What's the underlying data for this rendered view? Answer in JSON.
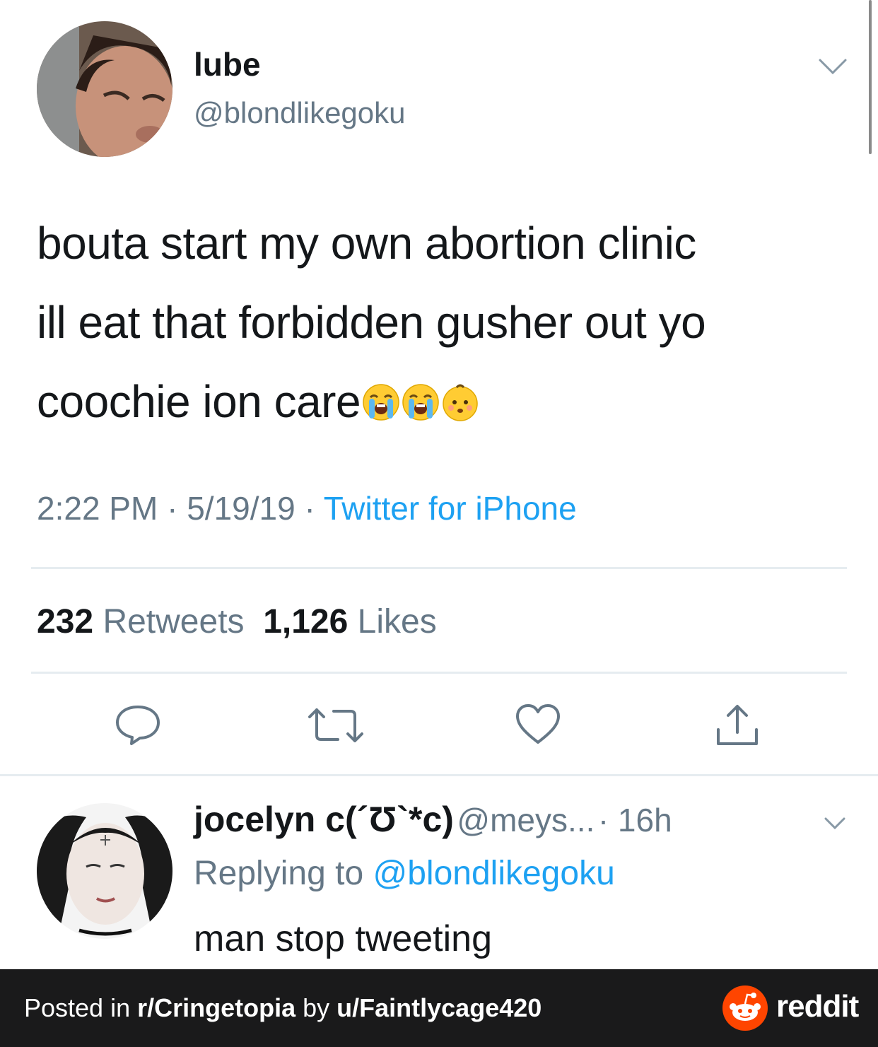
{
  "tweet": {
    "display_name": "lube",
    "handle": "@blondlikegoku",
    "text_lines": [
      "bouta start my own abortion clinic",
      "ill eat that forbidden gusher out yo",
      "coochie ion care"
    ],
    "emojis": [
      "loudly-crying-face",
      "loudly-crying-face",
      "baby-face"
    ],
    "time": "2:22 PM",
    "sep": "·",
    "date": "5/19/19",
    "source": "Twitter for iPhone",
    "retweets_count": "232",
    "retweets_label": "Retweets",
    "likes_count": "1,126",
    "likes_label": "Likes"
  },
  "actions": [
    "reply-icon",
    "retweet-icon",
    "heart-icon",
    "share-icon"
  ],
  "reply": {
    "display_name": "jocelyn c(´Ʊ`*c)",
    "handle": "@meys...",
    "age": "· 16h",
    "replying_prefix": "Replying to",
    "replying_to": "@blondlikegoku",
    "text": "man stop tweeting"
  },
  "footer": {
    "posted_in": "Posted in ",
    "subreddit": "r/Cringetopia",
    "by": " by ",
    "user": "u/Faintlycage420",
    "brand": "reddit"
  },
  "colors": {
    "link": "#1da1f2",
    "muted": "#657786",
    "footer_bg": "#1a1a1b",
    "reddit_orange": "#ff4500"
  }
}
